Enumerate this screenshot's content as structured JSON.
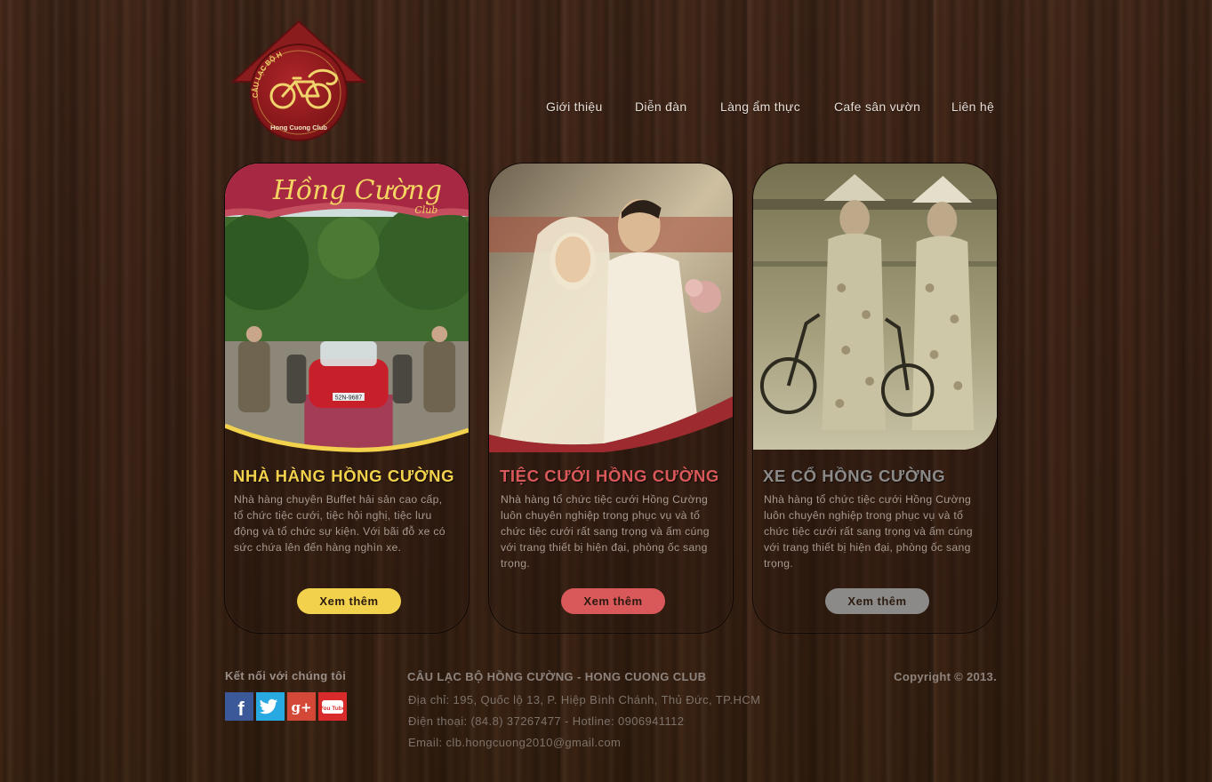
{
  "logo": {
    "arc_text": "CÂU LẠC BỘ HỒNG CƯỜNG",
    "bottom_text": "Hong Cuong Club",
    "colors": {
      "red": "#8e1c1c",
      "gold": "#e8c24a"
    }
  },
  "nav": [
    {
      "label": "Giới thiệu"
    },
    {
      "label": "Diễn đàn"
    },
    {
      "label": "Làng ẩm thực"
    },
    {
      "label": "Cafe sân vườn"
    },
    {
      "label": "Liên hệ"
    }
  ],
  "cards": [
    {
      "title": "NHÀ HÀNG HỒNG CƯỜNG",
      "sign_text": "Hồng Cường",
      "sign_sub": "Club",
      "plate": "52N-9687",
      "desc": "Nhà hàng chuyên Buffet hải sản cao cấp, tổ chức tiệc cưới, tiệc hội nghị, tiệc lưu động và tổ chức sự kiện. Với bãi đỗ xe có sức chứa lên đến hàng nghìn xe.",
      "button": "Xem thêm",
      "accent": "#f2d24d"
    },
    {
      "title": "TIỆC CƯỚI HỒNG CƯỜNG",
      "desc": "Nhà hàng tổ chức tiệc cưới Hồng Cường luôn chuyên nghiệp trong phục vụ và tổ chức tiệc cưới rất sang trọng và ấm cúng với trang thiết bị hiện đại, phòng ốc sang trọng.",
      "button": "Xem thêm",
      "accent": "#d9585a"
    },
    {
      "title": "XE CỔ HỒNG CƯỜNG",
      "desc": "Nhà hàng tổ chức tiệc cưới Hồng Cường luôn chuyên nghiệp trong phục vụ và tổ chức tiệc cưới rất sang trọng và ấm cúng với trang thiết bị hiện đại, phòng ốc sang trọng.",
      "button": "Xem thêm",
      "accent": "#8c8a88"
    }
  ],
  "footer": {
    "connect_label": "Kết nối với chúng tôi",
    "social": [
      {
        "icon": "facebook-icon",
        "glyph": "f",
        "color": "#3b5998"
      },
      {
        "icon": "twitter-icon",
        "color": "#29a9e1"
      },
      {
        "icon": "google-plus-icon",
        "glyph": "g+",
        "color": "#d34836"
      },
      {
        "icon": "youtube-icon",
        "glyph": "You Tube",
        "color": "#d92b2b"
      }
    ],
    "club_name": "CÂU LẠC BỘ HỒNG CƯỜNG - HONG CUONG CLUB",
    "address": "Địa chỉ: 195, Quốc lộ 13, P. Hiệp Bình Chánh, Thủ Đức, TP.HCM",
    "phone": "Điện thoại: (84.8) 37267477 - Hotline: 0906941112",
    "email": "Email: clb.hongcuong2010@gmail.com",
    "copyright": "Copyright © 2013."
  }
}
